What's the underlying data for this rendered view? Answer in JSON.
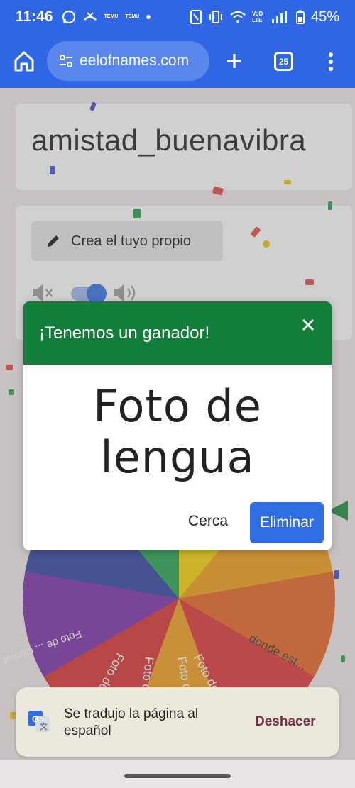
{
  "status": {
    "time": "11:46",
    "battery": "45%",
    "temu1": "TEMU",
    "temu2": "TEMU",
    "net": "VoD LTE"
  },
  "browser": {
    "url": "eelofnames.com",
    "tab_count": "25"
  },
  "page": {
    "wheel_title": "amistad_buenavibra",
    "crea_button": "Crea el tuyo propio",
    "wheel_labels": [
      "Foto de blanco",
      "Foto de azul",
      "Foto c/filtro div...",
      "Foto de piernas",
      "Foto de ... ciudad",
      "donde est..."
    ]
  },
  "modal": {
    "header": "¡Tenemos un ganador!",
    "winner_line1": "Foto de",
    "winner_line2": "lengua",
    "close_label": "Cerca",
    "remove_label": "Eliminar"
  },
  "snackbar": {
    "message": "Se tradujo la página al español",
    "action": "Deshacer"
  },
  "colors": {
    "browser_blue": "#2f66e3",
    "modal_header_green": "#127e3c",
    "eliminar_blue": "#2f6de3"
  }
}
